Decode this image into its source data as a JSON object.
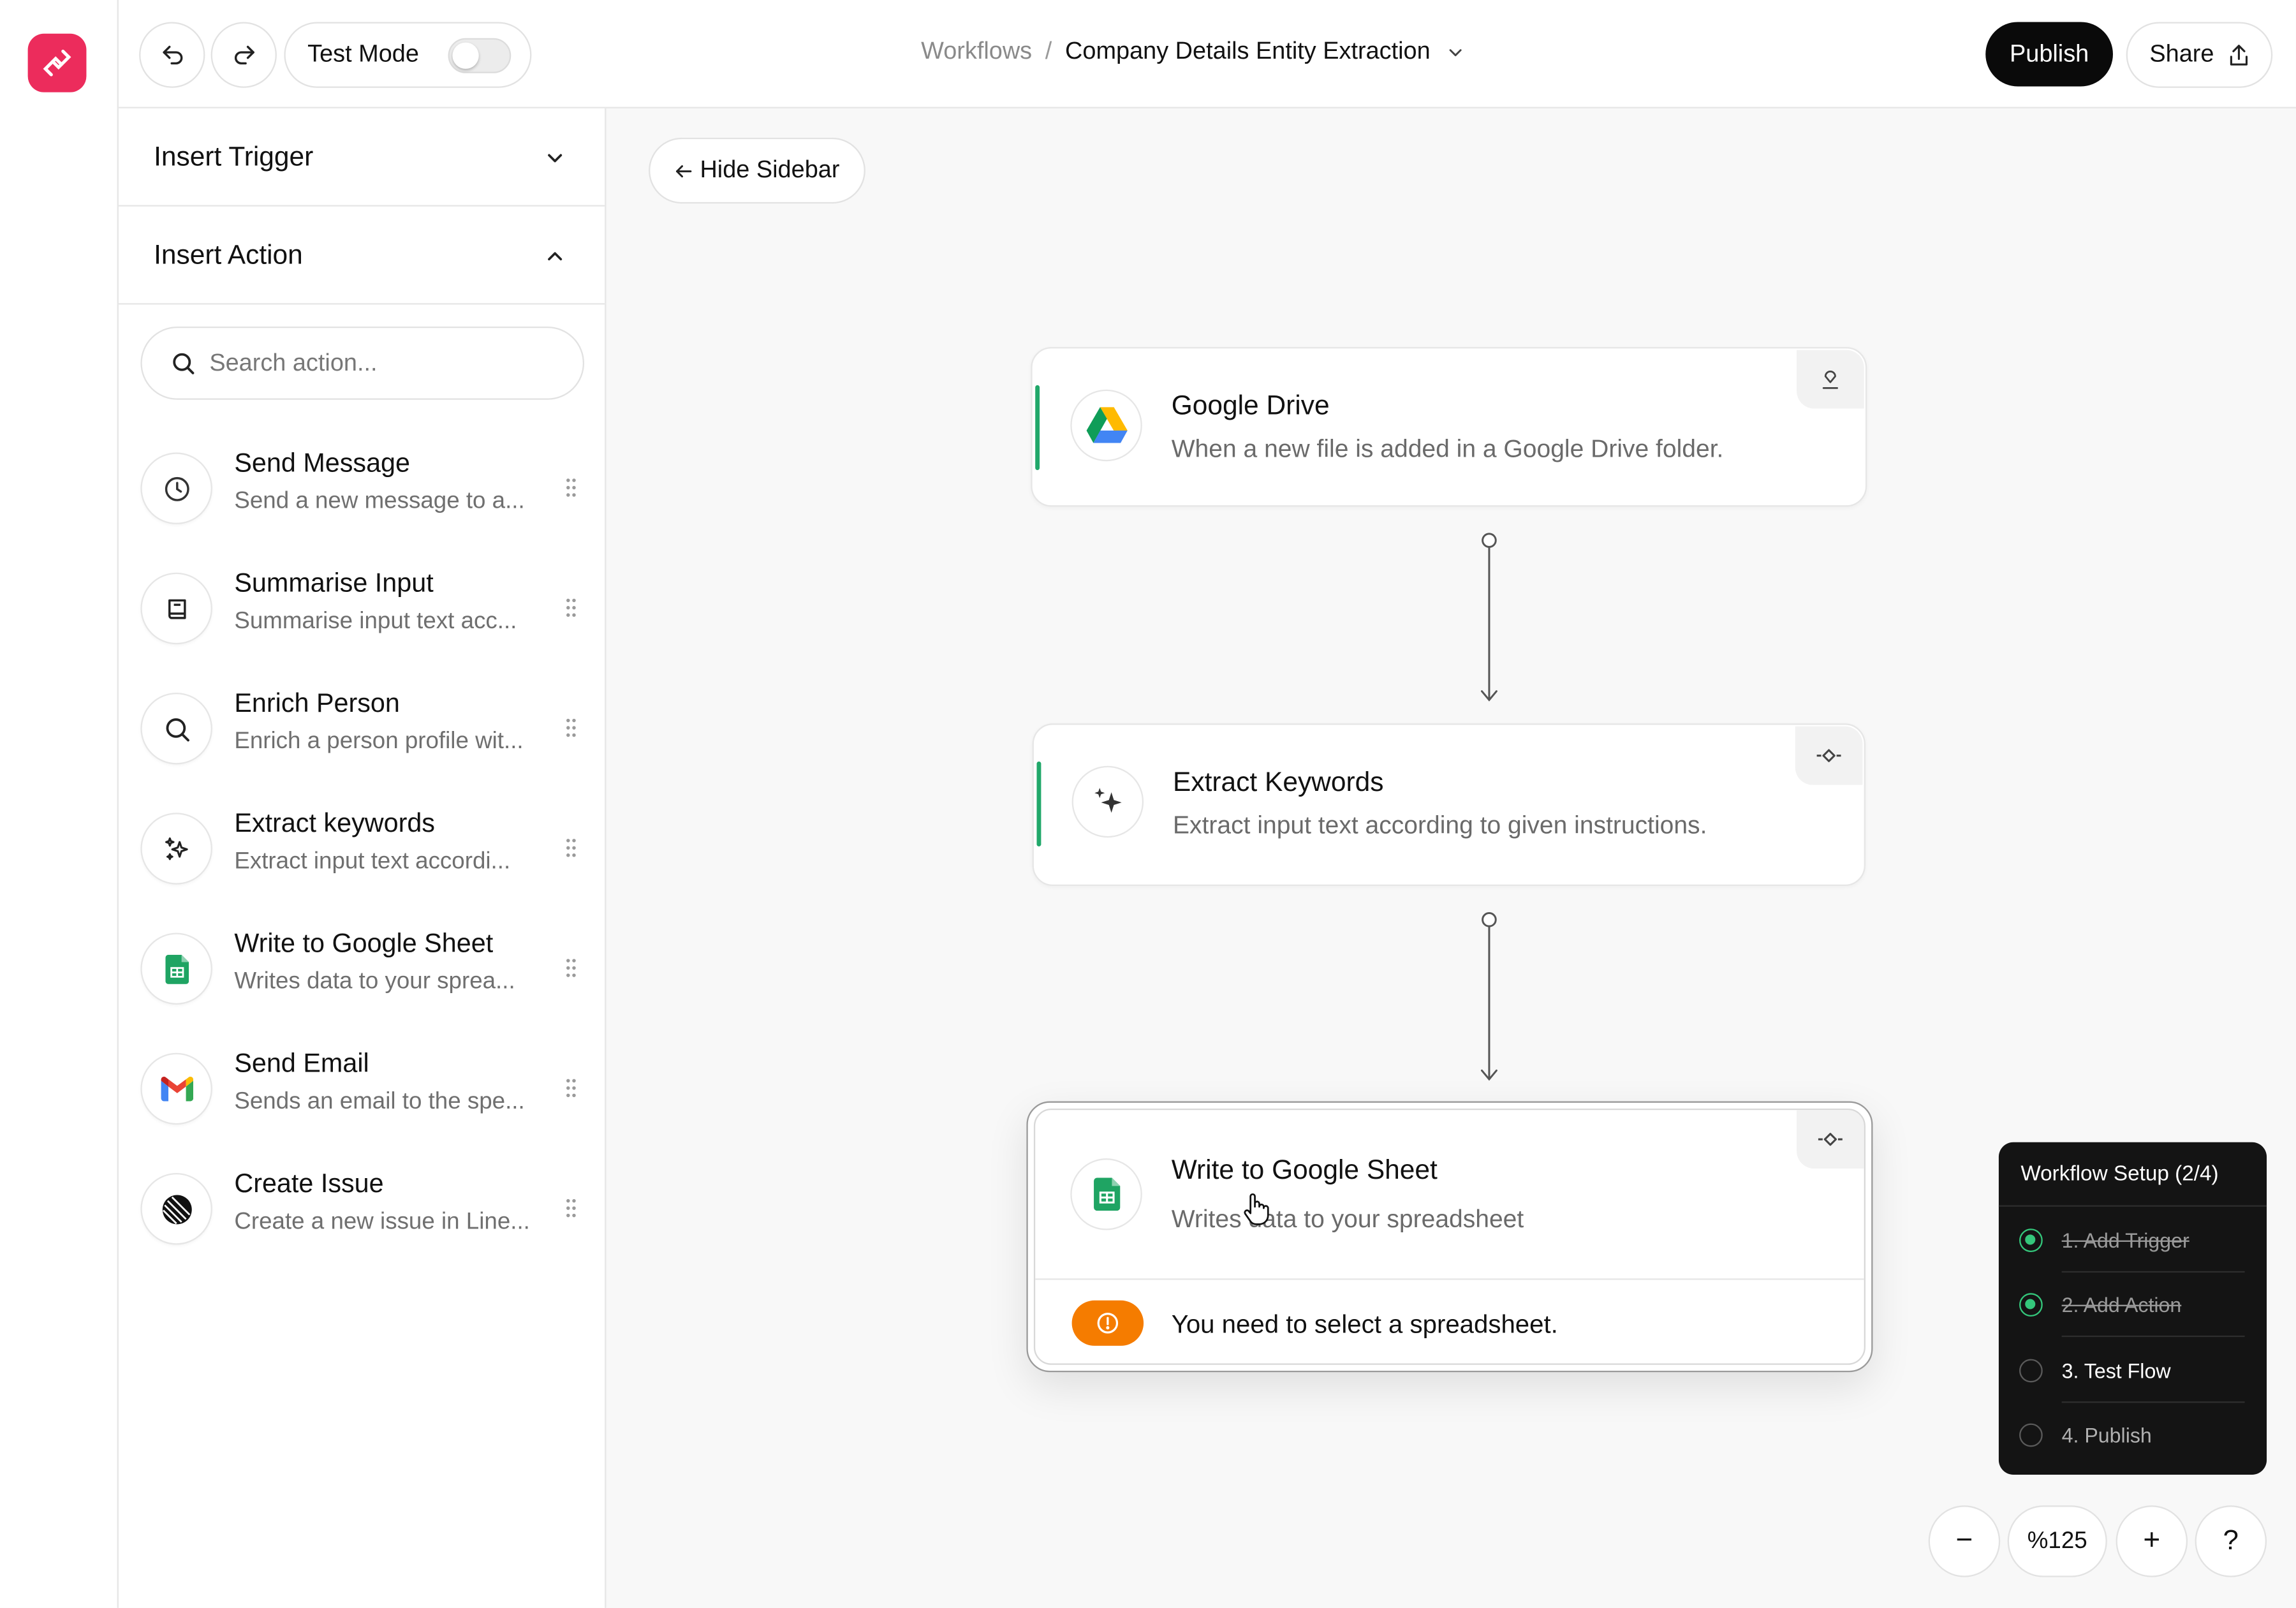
{
  "app": {
    "accent": "#ec2c5c",
    "icon": "workflow-logo-icon"
  },
  "topbar": {
    "undo_icon": "undo-icon",
    "redo_icon": "redo-icon",
    "test_mode_label": "Test Mode",
    "test_mode_on": false,
    "breadcrumb_root": "Workflows",
    "breadcrumb_separator": "/",
    "breadcrumb_current": "Company Details Entity Extraction",
    "publish_label": "Publish",
    "share_label": "Share"
  },
  "sidebar": {
    "insert_trigger_label": "Insert Trigger",
    "insert_action_label": "Insert Action",
    "search_placeholder": "Search action...",
    "actions": [
      {
        "title": "Send Message",
        "desc": "Send a new message to a...",
        "icon": "clock-icon"
      },
      {
        "title": "Summarise Input",
        "desc": "Summarise input text acc...",
        "icon": "book-icon"
      },
      {
        "title": "Enrich Person",
        "desc": "Enrich a person profile wit...",
        "icon": "search-icon"
      },
      {
        "title": "Extract keywords",
        "desc": "Extract input text accordi...",
        "icon": "sparkles-icon"
      },
      {
        "title": "Write to Google Sheet",
        "desc": "Writes data to your sprea...",
        "icon": "google-sheets-icon"
      },
      {
        "title": "Send Email",
        "desc": "Sends an email to the spe...",
        "icon": "gmail-icon"
      },
      {
        "title": "Create Issue",
        "desc": "Create a new issue in Line...",
        "icon": "linear-icon"
      }
    ]
  },
  "canvas": {
    "hide_sidebar_label": "Hide Sidebar",
    "nodes": [
      {
        "title": "Google Drive",
        "desc": "When a new file is added in a Google Drive folder.",
        "icon": "google-drive-icon"
      },
      {
        "title": "Extract Keywords",
        "desc": "Extract input text according to given instructions.",
        "icon": "sparkles-icon"
      },
      {
        "title": "Write to Google Sheet",
        "desc": "Writes data to your spreadsheet",
        "icon": "google-sheets-icon",
        "warning": "You need to select a spreadsheet."
      }
    ]
  },
  "setup": {
    "title": "Workflow Setup (2/4)",
    "steps": [
      {
        "label": "1. Add Trigger",
        "done": true
      },
      {
        "label": "2. Add Action",
        "done": true
      },
      {
        "label": "3. Test Flow",
        "done": false
      },
      {
        "label": "4. Publish",
        "done": false
      }
    ]
  },
  "zoom": {
    "minus": "−",
    "value": "%125",
    "plus": "+",
    "help": "?"
  },
  "colors": {
    "success": "#21a86a",
    "warning": "#f57c00",
    "dark": "#0a0a0a"
  }
}
